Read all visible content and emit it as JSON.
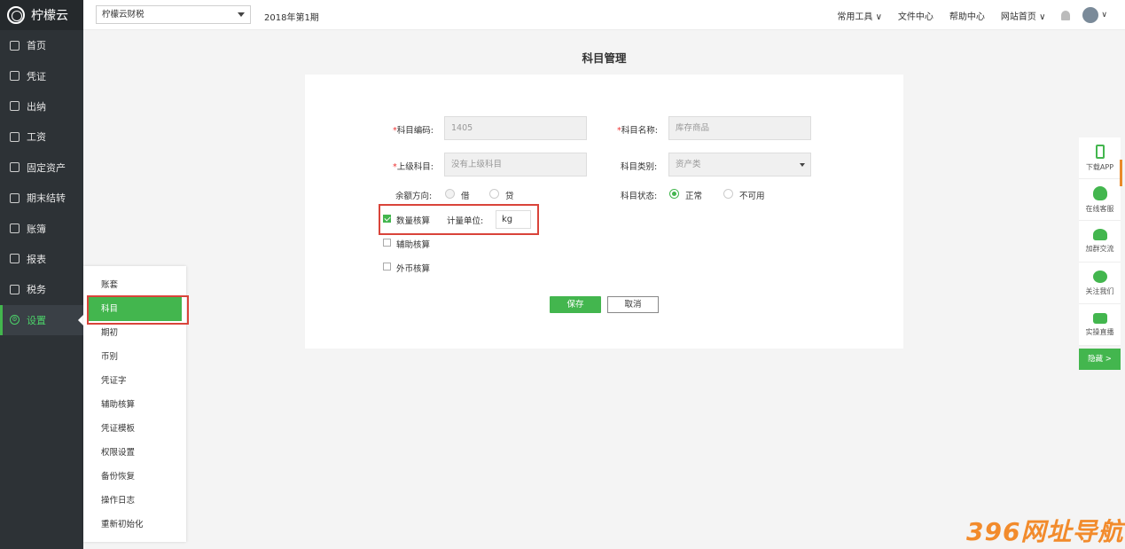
{
  "sidebar": {
    "logo": "柠檬云",
    "items": [
      {
        "label": "首页",
        "icon": "home-icon"
      },
      {
        "label": "凭证",
        "icon": "voucher-icon"
      },
      {
        "label": "出纳",
        "icon": "cashier-icon"
      },
      {
        "label": "工资",
        "icon": "salary-icon"
      },
      {
        "label": "固定资产",
        "icon": "asset-icon"
      },
      {
        "label": "期末结转",
        "icon": "calendar-icon"
      },
      {
        "label": "账簿",
        "icon": "ledger-icon"
      },
      {
        "label": "报表",
        "icon": "report-icon"
      },
      {
        "label": "税务",
        "icon": "tax-icon"
      },
      {
        "label": "设置",
        "icon": "gear-icon",
        "active": true
      }
    ]
  },
  "topbar": {
    "org": "柠檬云财税",
    "period": "2018年第1期",
    "links": [
      "常用工具 ∨",
      "文件中心",
      "帮助中心",
      "网站首页 ∨"
    ],
    "avatar_caret": "∨"
  },
  "page": {
    "title": "科目管理"
  },
  "form": {
    "code_label": "科目编码:",
    "code_value": "1405",
    "name_label": "科目名称:",
    "name_value": "库存商品",
    "parent_label": "上级科目:",
    "parent_value": "没有上级科目",
    "category_label": "科目类别:",
    "category_value": "资产类",
    "direction_label": "余额方向:",
    "direction_debit": "借",
    "direction_credit": "贷",
    "status_label": "科目状态:",
    "status_normal": "正常",
    "status_disabled": "不可用",
    "qty_label": "数量核算",
    "unit_label": "计量单位:",
    "unit_value": "kg",
    "aux_label": "辅助核算",
    "fx_label": "外币核算",
    "save": "保存",
    "cancel": "取消",
    "required_mark": "*"
  },
  "submenu": [
    "账套",
    "科目",
    "期初",
    "币别",
    "凭证字",
    "辅助核算",
    "凭证模板",
    "权限设置",
    "备份恢复",
    "操作日志",
    "重新初始化"
  ],
  "right_panel": [
    {
      "label": "下载APP",
      "icon": "phone-icon"
    },
    {
      "label": "在线客服",
      "icon": "qq-icon"
    },
    {
      "label": "加群交流",
      "icon": "group-icon"
    },
    {
      "label": "关注我们",
      "icon": "wechat-icon"
    },
    {
      "label": "实操直播",
      "icon": "live-icon"
    }
  ],
  "right_panel_hide": "隐藏 >",
  "watermark": "396网址导航",
  "colors": {
    "accent": "#43b64e",
    "sidebar": "#2d3236",
    "highlight": "#d9443a"
  }
}
